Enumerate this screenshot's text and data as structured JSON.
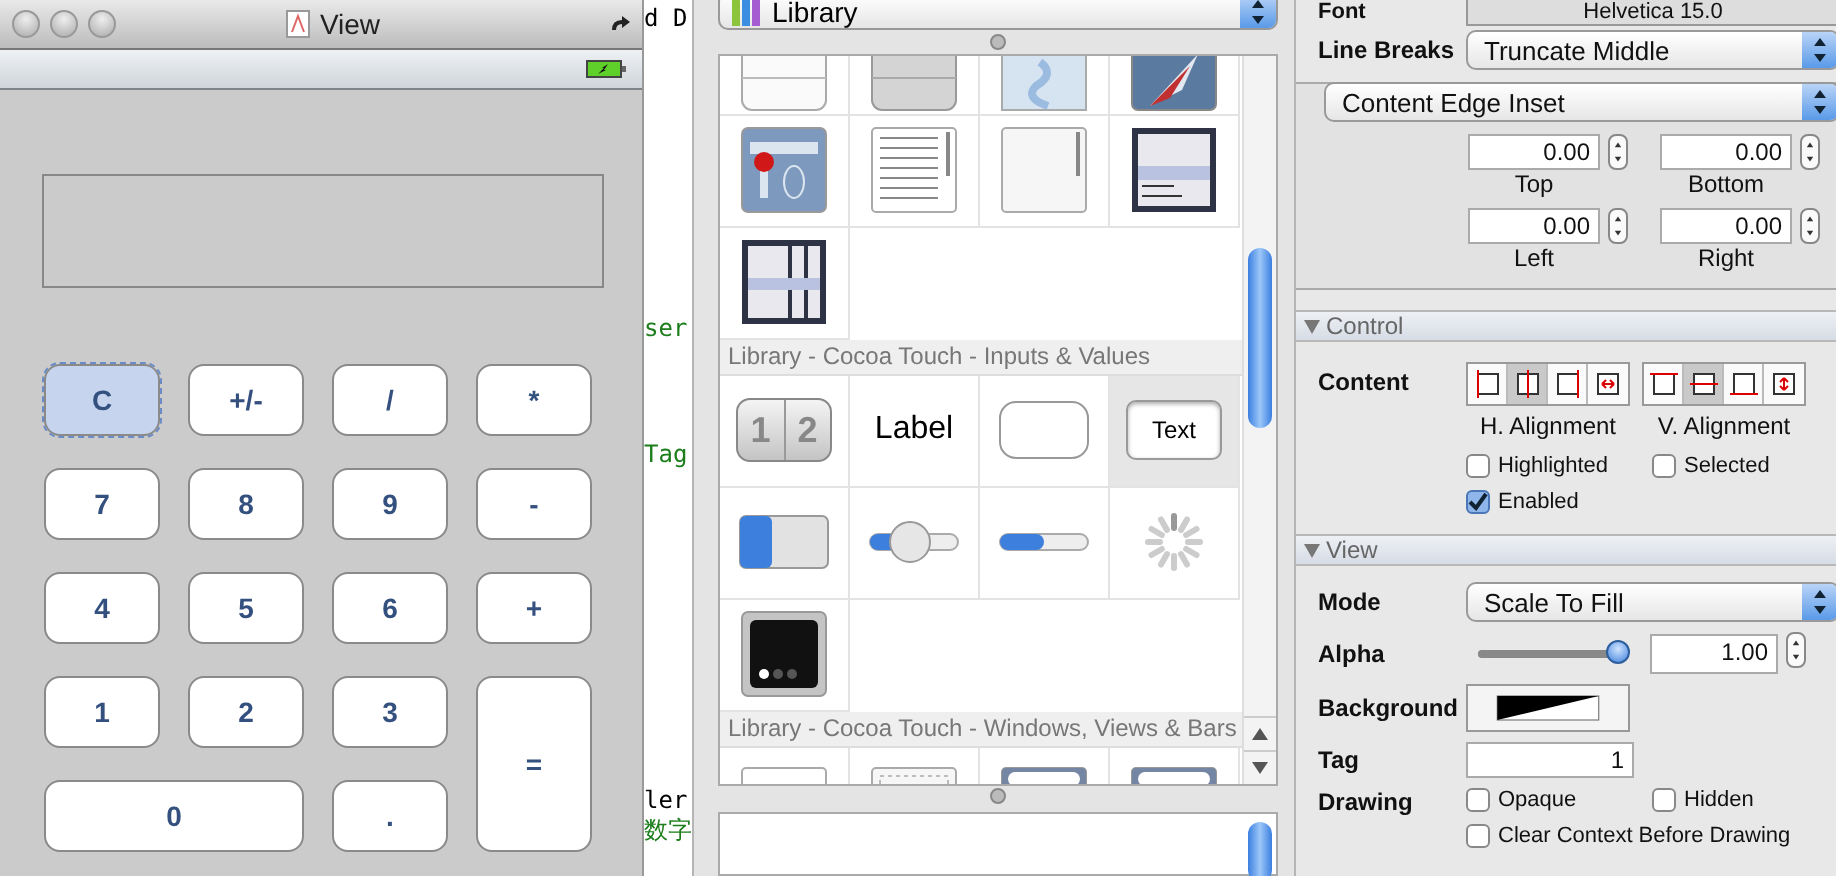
{
  "view_window": {
    "title": "View",
    "display": {
      "kind": "empty"
    },
    "buttons": [
      {
        "label": "C",
        "selected": true,
        "kind": "normal"
      },
      {
        "label": "+/-",
        "selected": false,
        "kind": "normal"
      },
      {
        "label": "/",
        "selected": false,
        "kind": "normal"
      },
      {
        "label": "*",
        "selected": false,
        "kind": "normal"
      },
      {
        "label": "7",
        "selected": false,
        "kind": "normal"
      },
      {
        "label": "8",
        "selected": false,
        "kind": "normal"
      },
      {
        "label": "9",
        "selected": false,
        "kind": "normal"
      },
      {
        "label": "-",
        "selected": false,
        "kind": "normal"
      },
      {
        "label": "4",
        "selected": false,
        "kind": "normal"
      },
      {
        "label": "5",
        "selected": false,
        "kind": "normal"
      },
      {
        "label": "6",
        "selected": false,
        "kind": "normal"
      },
      {
        "label": "+",
        "selected": false,
        "kind": "normal"
      },
      {
        "label": "1",
        "selected": false,
        "kind": "normal"
      },
      {
        "label": "2",
        "selected": false,
        "kind": "normal"
      },
      {
        "label": "3",
        "selected": false,
        "kind": "normal"
      },
      {
        "label": "=",
        "selected": false,
        "kind": "tall"
      },
      {
        "label": "0",
        "selected": false,
        "kind": "wide"
      },
      {
        "label": ".",
        "selected": false,
        "kind": "normal"
      }
    ]
  },
  "code_fragments": [
    {
      "text": "d D",
      "kind": "code"
    },
    {
      "text": "ser",
      "kind": "comment"
    },
    {
      "text": "Tag",
      "kind": "comment"
    },
    {
      "text": "ler",
      "kind": "code"
    },
    {
      "text": "数字",
      "kind": "comment"
    }
  ],
  "library": {
    "popup": "Library",
    "sections": [
      {
        "items": [
          {
            "kind": "table-plain",
            "selected": false
          },
          {
            "kind": "table-grouped",
            "selected": false
          },
          {
            "kind": "map",
            "selected": false
          },
          {
            "kind": "compass",
            "selected": false
          },
          {
            "kind": "pin-view",
            "selected": false
          },
          {
            "kind": "text-view",
            "selected": false
          },
          {
            "kind": "scroll-view",
            "selected": false
          },
          {
            "kind": "picker",
            "selected": false
          },
          {
            "kind": "date-picker",
            "selected": false
          }
        ]
      },
      {
        "title": "Library - Cocoa Touch - Inputs & Values",
        "items": [
          {
            "kind": "segmented",
            "segments": [
              "1",
              "2"
            ],
            "selected": false
          },
          {
            "kind": "label",
            "text": "Label",
            "selected": false
          },
          {
            "kind": "button",
            "selected": false
          },
          {
            "kind": "text-field",
            "text": "Text",
            "selected": true
          },
          {
            "kind": "switch",
            "selected": false
          },
          {
            "kind": "slider",
            "selected": false
          },
          {
            "kind": "progress",
            "selected": false
          },
          {
            "kind": "activity",
            "selected": false
          },
          {
            "kind": "page-control",
            "selected": false
          }
        ]
      },
      {
        "title": "Library - Cocoa Touch - Windows, Views & Bars",
        "items": [
          {
            "kind": "view",
            "selected": false
          },
          {
            "kind": "image-view",
            "selected": false
          },
          {
            "kind": "search-bar",
            "selected": false
          },
          {
            "kind": "search-display",
            "selected": false
          }
        ]
      }
    ]
  },
  "inspector": {
    "font": {
      "label": "Font",
      "value": "Helvetica 15.0"
    },
    "line_breaks": {
      "label": "Line Breaks",
      "value": "Truncate Middle"
    },
    "inset": {
      "popup": "Content Edge Inset",
      "fields": [
        {
          "label": "Top",
          "value": "0.00"
        },
        {
          "label": "Bottom",
          "value": "0.00"
        },
        {
          "label": "Left",
          "value": "0.00"
        },
        {
          "label": "Right",
          "value": "0.00"
        }
      ]
    },
    "control": {
      "title": "Control",
      "expanded": true,
      "content_label": "Content",
      "h_alignment": {
        "label": "H. Alignment",
        "options": [
          {
            "kind": "left",
            "selected": false
          },
          {
            "kind": "center",
            "selected": true
          },
          {
            "kind": "right",
            "selected": false
          },
          {
            "kind": "fill",
            "selected": false
          }
        ]
      },
      "v_alignment": {
        "label": "V. Alignment",
        "options": [
          {
            "kind": "top",
            "selected": false
          },
          {
            "kind": "center",
            "selected": true
          },
          {
            "kind": "bottom",
            "selected": false
          },
          {
            "kind": "fill",
            "selected": false
          }
        ]
      },
      "checkboxes": [
        {
          "label": "Highlighted",
          "checked": false
        },
        {
          "label": "Selected",
          "checked": false
        },
        {
          "label": "Enabled",
          "checked": true
        }
      ]
    },
    "view": {
      "title": "View",
      "expanded": true,
      "mode": {
        "label": "Mode",
        "value": "Scale To Fill"
      },
      "alpha": {
        "label": "Alpha",
        "level": 1,
        "value": "1.00"
      },
      "background": {
        "label": "Background"
      },
      "tag": {
        "label": "Tag",
        "value": "1"
      },
      "drawing": {
        "label": "Drawing",
        "checkboxes": [
          {
            "label": "Opaque",
            "checked": false
          },
          {
            "label": "Hidden",
            "checked": false
          },
          {
            "label": "Clear Context Before Drawing",
            "checked": false
          }
        ]
      }
    }
  }
}
